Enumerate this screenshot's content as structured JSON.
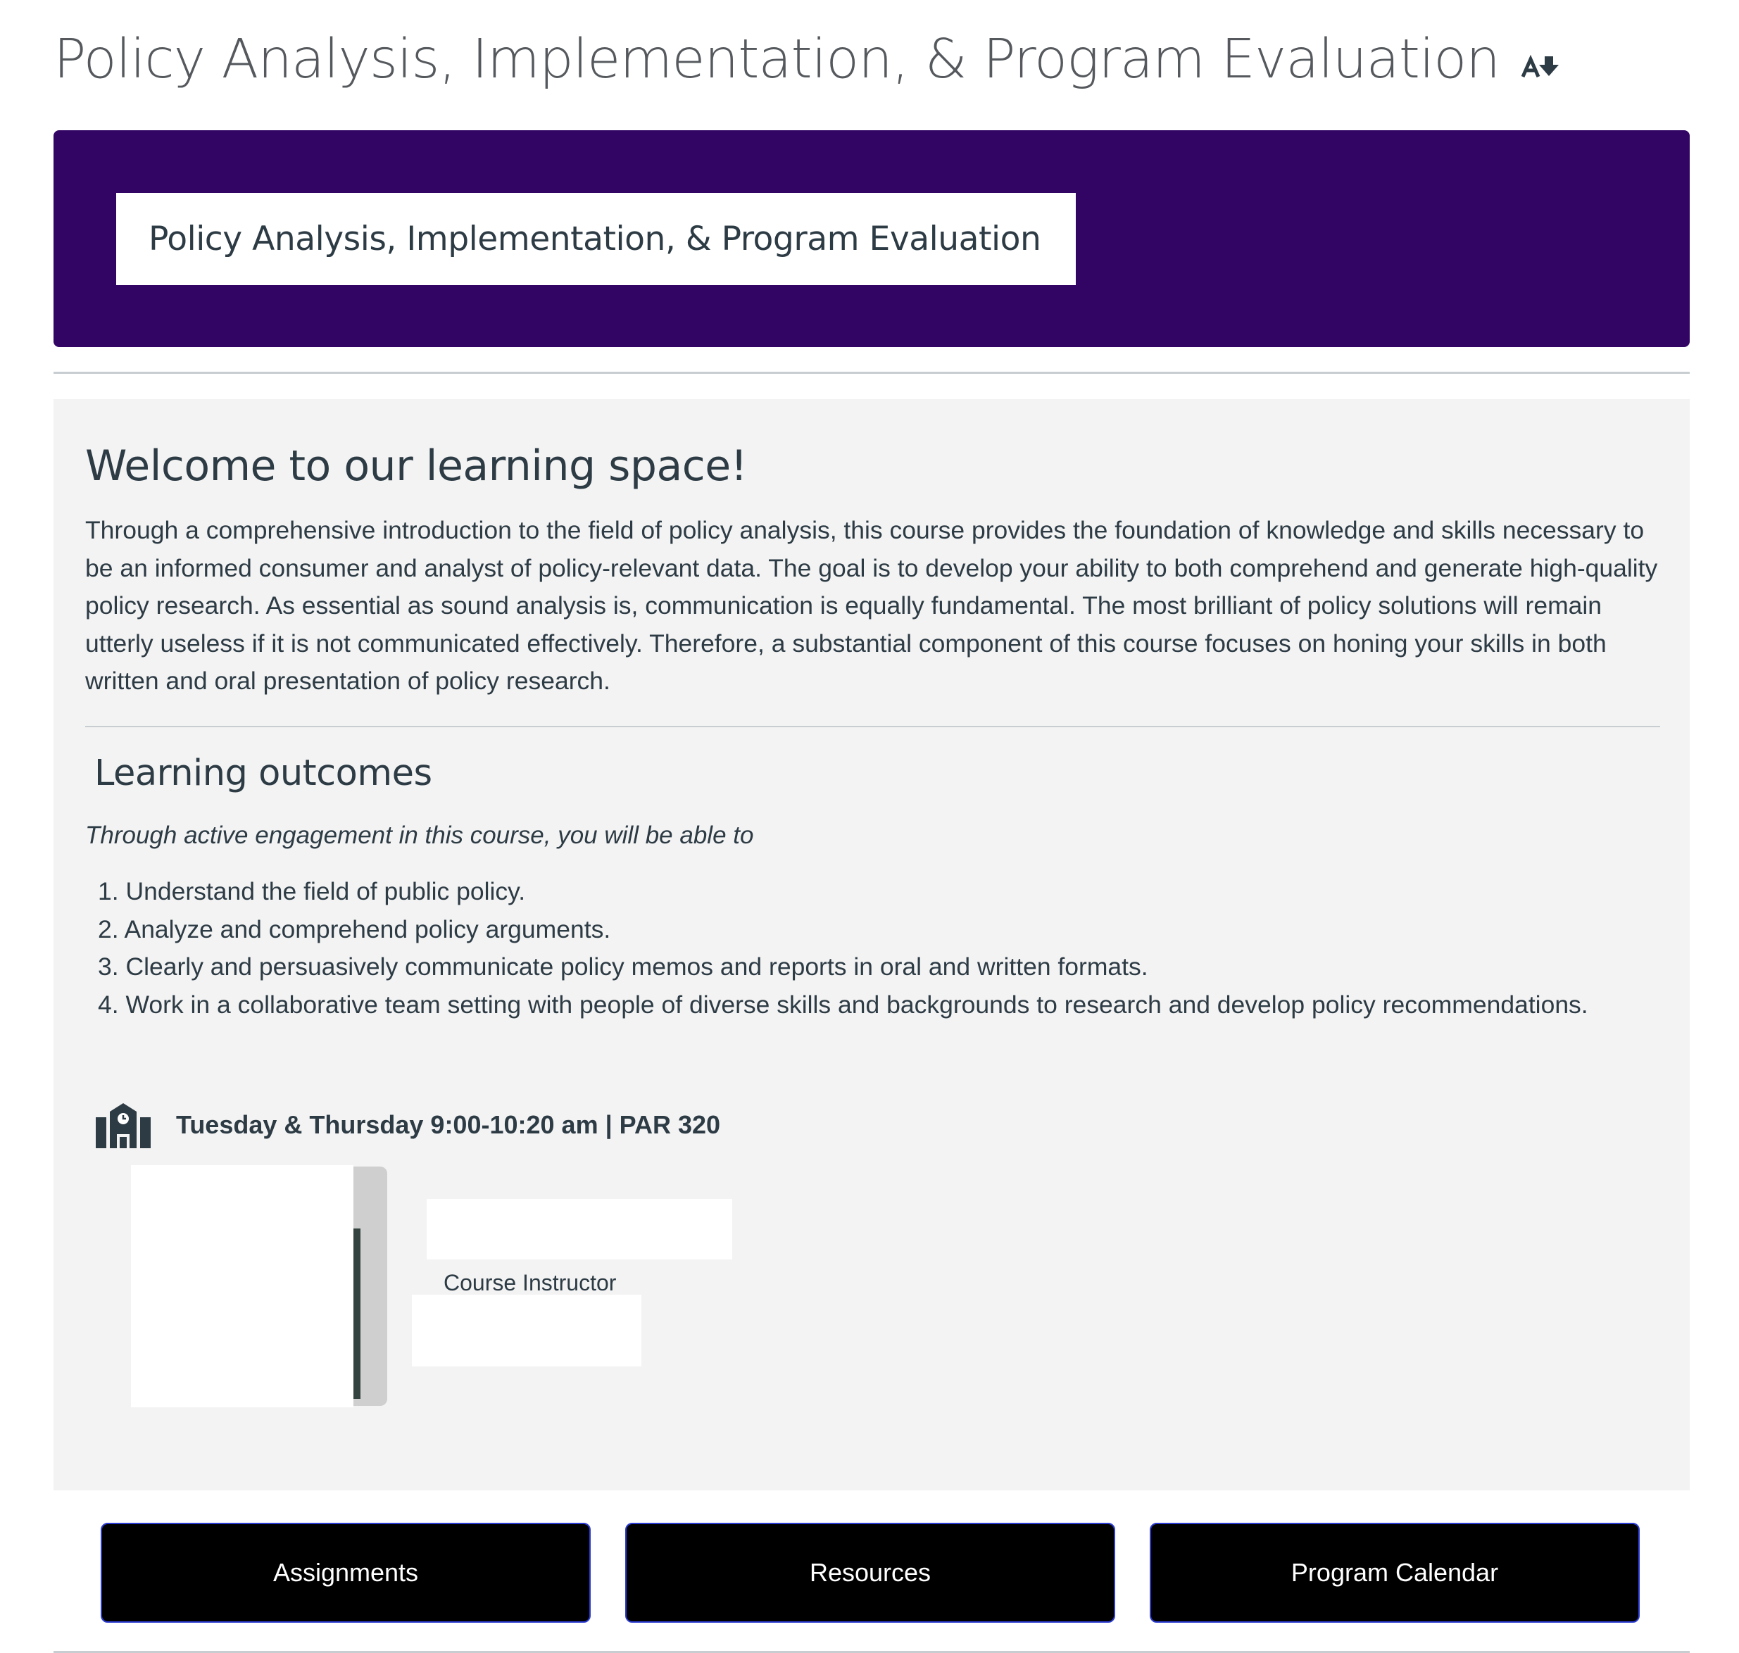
{
  "page": {
    "title": "Policy Analysis, Implementation, & Program Evaluation",
    "title_icon": "text-size-down-icon"
  },
  "banner": {
    "title": "Policy Analysis, Implementation, & Program Evaluation",
    "background_color": "#320565"
  },
  "welcome": {
    "heading": "Welcome to our learning space!",
    "description": "Through a comprehensive introduction to the field of policy analysis, this course provides the foundation of knowledge and skills necessary to be an informed consumer and analyst of policy-relevant data. The goal is to develop your ability to both comprehend and generate high-quality policy research. As essential as sound analysis is, communication is equally fundamental. The most brilliant of policy solutions will remain utterly useless if it is not communicated effectively. Therefore, a substantial component of this course focuses on honing your skills in both written and oral presentation of policy research."
  },
  "outcomes": {
    "heading": "Learning outcomes",
    "intro": "Through active engagement in this course, you will be able to",
    "items": [
      "1. Understand the field of public policy.",
      "2. Analyze and comprehend policy arguments.",
      "3. Clearly and persuasively communicate policy memos and reports in oral and written formats.",
      "4. Work in a collaborative team setting with people of diverse skills and backgrounds to research and develop policy recommendations."
    ]
  },
  "schedule": {
    "icon": "school-building-icon",
    "text": "Tuesday & Thursday 9:00-10:20 am | PAR 320"
  },
  "instructor": {
    "role": "Course Instructor"
  },
  "nav": {
    "buttons": [
      "Assignments",
      "Resources",
      "Program Calendar"
    ],
    "button_color": "#000000",
    "button_border_color": "#2b3bd1"
  }
}
